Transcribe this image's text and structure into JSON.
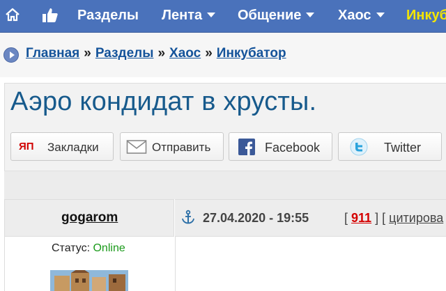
{
  "nav": {
    "items": [
      {
        "label": "Разделы",
        "has_arrow": false
      },
      {
        "label": "Лента",
        "has_arrow": true
      },
      {
        "label": "Общение",
        "has_arrow": true
      },
      {
        "label": "Хаос",
        "has_arrow": true
      },
      {
        "label": "Инкуб",
        "has_arrow": false
      }
    ],
    "icons": [
      "home-icon",
      "thumbs-up-icon"
    ],
    "bg_color": "#4a72bb",
    "highlight_color": "#f5e600"
  },
  "breadcrumb": {
    "items": [
      "Главная",
      "Разделы",
      "Хаос",
      "Инкубатор"
    ],
    "separator": "»"
  },
  "post": {
    "title": "Аэро кондидат в хрусты.",
    "share": {
      "bookmarks": "Закладки",
      "bookmarks_badge": "ЯП",
      "send": "Отправить",
      "facebook": "Facebook",
      "twitter": "Twitter"
    },
    "author": "gogarom",
    "status_label": "Статус:",
    "status_value": "Online",
    "date": "27.04.2020 - 19:55",
    "number": "911",
    "bracket_open": "[",
    "bracket_close": "]",
    "cite": "цитирова"
  }
}
